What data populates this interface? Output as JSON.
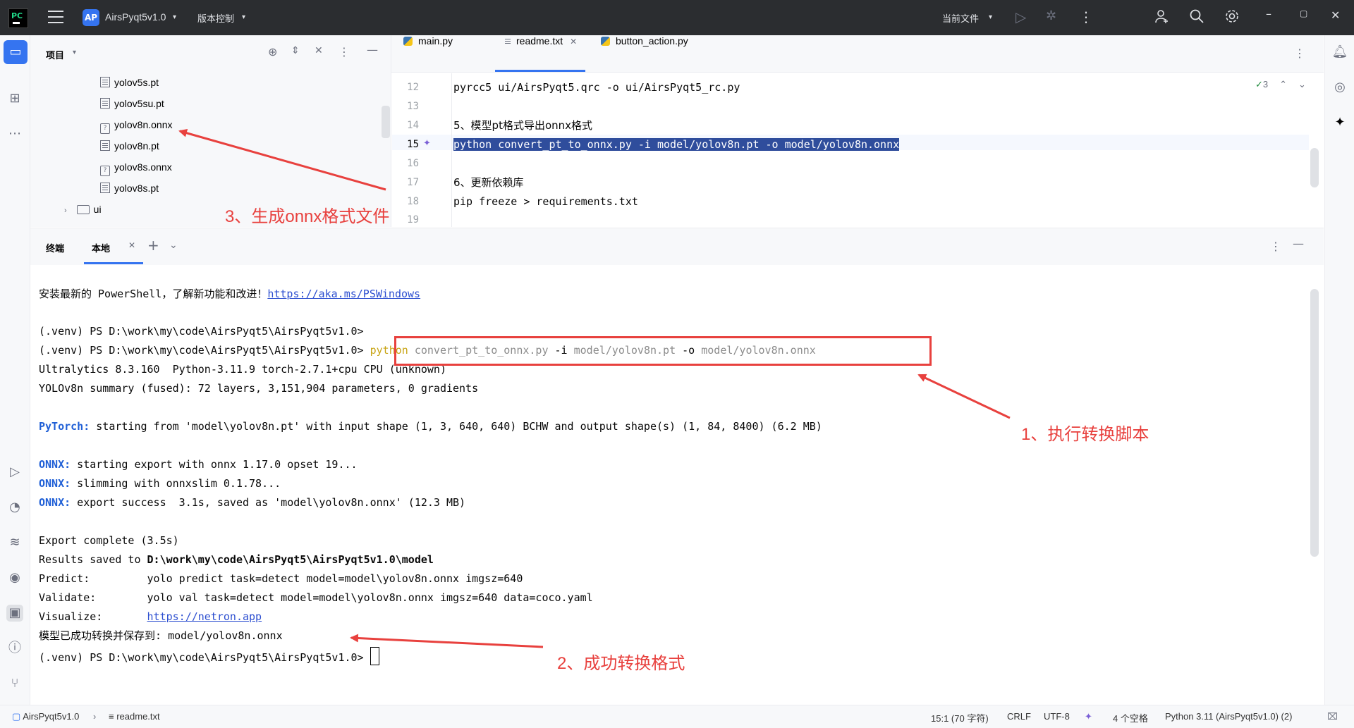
{
  "titlebar": {
    "project_badge": "AP",
    "project_name": "AirsPyqt5v1.0",
    "vcs": "版本控制",
    "run_config": "当前文件"
  },
  "project_panel": {
    "title": "项目",
    "files": [
      {
        "name": "yolov5s.pt",
        "icon": "text-file-icon"
      },
      {
        "name": "yolov5su.pt",
        "icon": "text-file-icon"
      },
      {
        "name": "yolov8n.onnx",
        "icon": "unknown-file-icon"
      },
      {
        "name": "yolov8n.pt",
        "icon": "text-file-icon"
      },
      {
        "name": "yolov8s.onnx",
        "icon": "unknown-file-icon"
      },
      {
        "name": "yolov8s.pt",
        "icon": "text-file-icon"
      }
    ],
    "folder": "ui"
  },
  "editor": {
    "tabs": [
      {
        "label": "main.py"
      },
      {
        "label": "readme.txt"
      },
      {
        "label": "button_action.py"
      }
    ],
    "inspection_count": "3",
    "lines": [
      {
        "no": "12",
        "text": "pyrcc5 ui/AirsPyqt5.qrc -o ui/AirsPyqt5_rc.py"
      },
      {
        "no": "13",
        "text": ""
      },
      {
        "no": "14",
        "text": "5、模型pt格式导出onnx格式"
      },
      {
        "no": "15",
        "text": "python convert_pt_to_onnx.py -i model/yolov8n.pt -o model/yolov8n.onnx"
      },
      {
        "no": "16",
        "text": ""
      },
      {
        "no": "17",
        "text": "6、更新依赖库"
      },
      {
        "no": "18",
        "text": "pip freeze > requirements.txt"
      },
      {
        "no": "19",
        "text": ""
      }
    ]
  },
  "terminal": {
    "title": "终端",
    "tab": "本地",
    "lines": {
      "l1_text": "安装最新的 PowerShell，了解新功能和改进！",
      "l1_link": "https://aka.ms/PSWindows",
      "prompt1": "(.venv) PS D:\\work\\my\\code\\AirsPyqt5\\AirsPyqt5v1.0>",
      "prompt2": "(.venv) PS D:\\work\\my\\code\\AirsPyqt5\\AirsPyqt5v1.0>",
      "cmd_python": "python",
      "cmd_script": " convert_pt_to_onnx.py ",
      "cmd_i": "-i",
      "cmd_in": " model/yolov8n.pt ",
      "cmd_o": "-o",
      "cmd_out": " model/yolov8n.onnx",
      "ultra": "Ultralytics 8.3.160  Python-3.11.9 torch-2.7.1+cpu CPU (unknown)",
      "summary": "YOLOv8n summary (fused): 72 layers, 3,151,904 parameters, 0 gradients",
      "pytorch_kw": "PyTorch:",
      "pytorch_txt": " starting from 'model\\yolov8n.pt' with input shape (1, 3, 640, 640) BCHW and output shape(s) (1, 84, 8400) (6.2 MB)",
      "onnx_kw": "ONNX:",
      "onnx1": " starting export with onnx 1.17.0 opset 19...",
      "onnx2": " slimming with onnxslim 0.1.78...",
      "onnx3": " export success  3.1s, saved as 'model\\yolov8n.onnx' (12.3 MB)",
      "export_done": "Export complete (3.5s)",
      "results_pre": "Results saved to ",
      "results_path": "D:\\work\\my\\code\\AirsPyqt5\\AirsPyqt5v1.0\\model",
      "predict_k": "Predict:         ",
      "predict_v": "yolo predict task=detect model=model\\yolov8n.onnx imgsz=640",
      "validate_k": "Validate:        ",
      "validate_v": "yolo val task=detect model=model\\yolov8n.onnx imgsz=640 data=coco.yaml",
      "visualize_k": "Visualize:       ",
      "visualize_v": "https://netron.app",
      "saved_msg": "模型已成功转换并保存到: model/yolov8n.onnx",
      "prompt3": "(.venv) PS D:\\work\\my\\code\\AirsPyqt5\\AirsPyqt5v1.0> "
    }
  },
  "annotations": {
    "a1": "1、执行转换脚本",
    "a2": "2、成功转换格式",
    "a3": "3、生成onnx格式文件"
  },
  "statusbar": {
    "project": "AirsPyqt5v1.0",
    "file": "readme.txt",
    "position": "15:1 (70 字符)",
    "line_sep": "CRLF",
    "encoding": "UTF-8",
    "indent": "4 个空格",
    "interpreter": "Python 3.11 (AirsPyqt5v1.0) (2)"
  },
  "colors": {
    "accent": "#3574f0",
    "annotation_red": "#e8413e",
    "selection": "#2f4d9c"
  }
}
